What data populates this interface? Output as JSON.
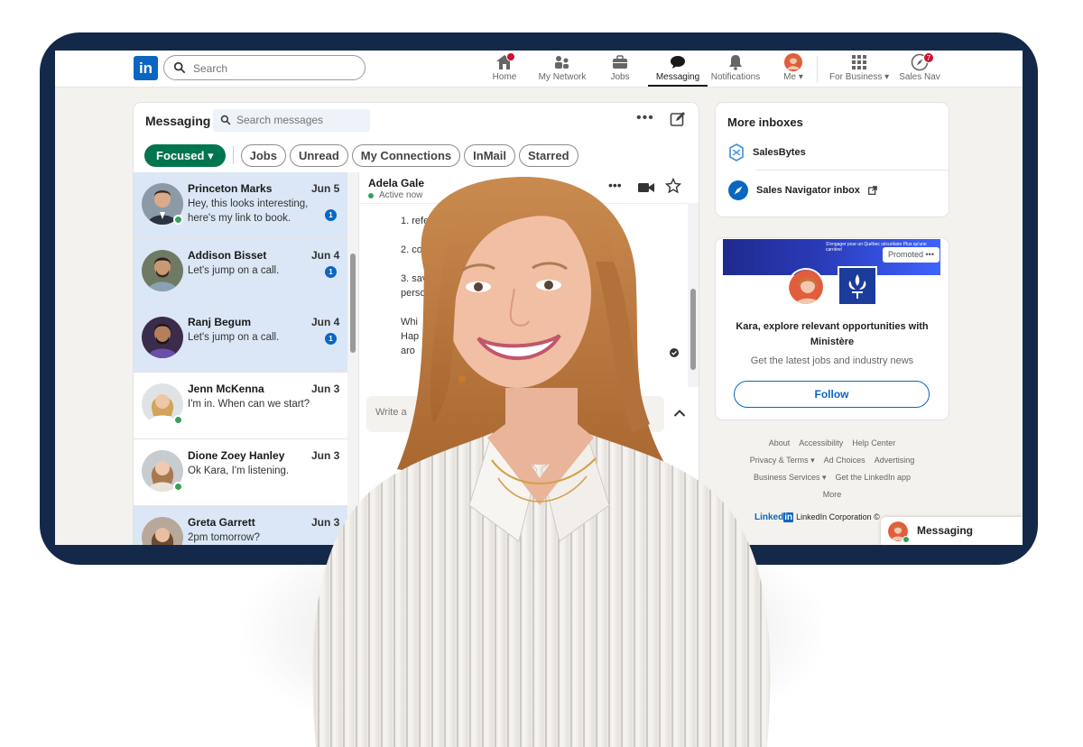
{
  "colors": {
    "frame": "#14284a",
    "brand": "#0a66c2",
    "focused": "#01754f",
    "unread": "#dbe7f6",
    "online": "#37a05b",
    "badge": "#cb112d"
  },
  "nav": {
    "logo": "in",
    "search_placeholder": "Search",
    "items": [
      {
        "label": "Home",
        "icon": "home-icon",
        "badge": ""
      },
      {
        "label": "My Network",
        "icon": "network-icon",
        "badge": ""
      },
      {
        "label": "Jobs",
        "icon": "briefcase-icon",
        "badge": ""
      },
      {
        "label": "Messaging",
        "icon": "messaging-icon",
        "badge": ""
      },
      {
        "label": "Notifications",
        "icon": "bell-icon",
        "badge": ""
      },
      {
        "label": "Me",
        "icon": "avatar",
        "badge": ""
      },
      {
        "label": "For Business",
        "icon": "grid-icon",
        "badge": ""
      },
      {
        "label": "Sales Nav",
        "icon": "compass-icon",
        "badge": "7"
      }
    ]
  },
  "messaging": {
    "title": "Messaging",
    "search_placeholder": "Search messages",
    "more": "•••",
    "filters": [
      "Focused",
      "Jobs",
      "Unread",
      "My Connections",
      "InMail",
      "Starred"
    ],
    "conversations": [
      {
        "name": "Princeton Marks",
        "date": "Jun 5",
        "preview": "Hey, this looks interesting, here's my link to book.",
        "count": "1"
      },
      {
        "name": "Addison Bisset",
        "date": "Jun 4",
        "preview": "Let's jump on a call.",
        "count": "1"
      },
      {
        "name": "Ranj Begum",
        "date": "Jun 4",
        "preview": "Let's jump on a call.",
        "count": "1"
      },
      {
        "name": "Jenn McKenna",
        "date": "Jun 3",
        "preview": "I'm in. When can we start?",
        "count": ""
      },
      {
        "name": "Dione Zoey Hanley",
        "date": "Jun 3",
        "preview": "Ok Kara, I'm listening.",
        "count": ""
      },
      {
        "name": "Greta Garrett",
        "date": "Jun 3",
        "preview": "2pm tomorrow?",
        "count": ""
      }
    ],
    "thread": {
      "name": "Adela Gale",
      "status": "Active now",
      "more": "•••",
      "lines": [
        "1. referral",
        "2. cold",
        "3. sav",
        "perso",
        "Whi",
        "Hap",
        "aro"
      ],
      "input_placeholder": "Write a"
    }
  },
  "inboxes": {
    "title": "More inboxes",
    "items": [
      {
        "label": "SalesBytes",
        "icon": "salesbytes-icon"
      },
      {
        "label": "Sales Navigator inbox",
        "icon": "compass-icon"
      }
    ]
  },
  "promo": {
    "banner_text": "S'engager pour un Québec sécuritaire Plus qu'une carrière!",
    "promoted": "Promoted •••",
    "title": "Kara, explore relevant opportunities with Ministère",
    "subtitle": "Get the latest jobs and industry news",
    "button": "Follow"
  },
  "footer": {
    "row1": [
      "About",
      "Accessibility",
      "Help Center"
    ],
    "row2": [
      "Privacy & Terms ▾",
      "Ad Choices",
      "Advertising"
    ],
    "row3": [
      "Business Services ▾",
      "Get the LinkedIn app"
    ],
    "row4": [
      "More"
    ],
    "brand": "Linked",
    "brand_in": "in",
    "corp": "LinkedIn Corporation ©"
  },
  "widget": {
    "label": "Messaging"
  }
}
